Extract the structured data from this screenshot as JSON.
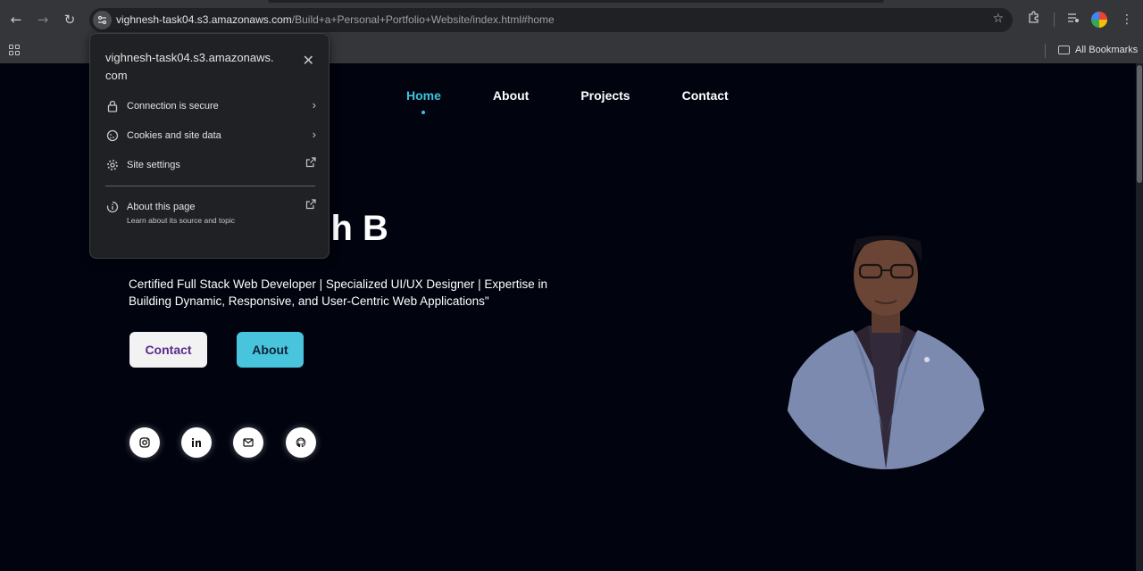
{
  "browser": {
    "url_host": "vighnesh-task04.s3.amazonaws.com",
    "url_path": "/Build+a+Personal+Portfolio+Website/index.html#home",
    "all_bookmarks_label": "All Bookmarks"
  },
  "site_info_popup": {
    "host": "vighnesh-task04.s3.amazonaws.com",
    "items": [
      {
        "label": "Connection is secure"
      },
      {
        "label": "Cookies and site data"
      },
      {
        "label": "Site settings"
      }
    ],
    "about": {
      "label": "About this page",
      "sublabel": "Learn about its source and topic"
    }
  },
  "site": {
    "nav": [
      {
        "label": "Home",
        "active": true
      },
      {
        "label": "About",
        "active": false
      },
      {
        "label": "Projects",
        "active": false
      },
      {
        "label": "Contact",
        "active": false
      }
    ],
    "hero_name_visible": "esh B",
    "tagline": "Certified Full Stack Web Developer | Specialized UI/UX Designer | Expertise in Building Dynamic, Responsive, and User-Centric Web Applications\"",
    "buttons": {
      "contact": "Contact",
      "about": "About"
    },
    "socials": [
      "instagram-icon",
      "linkedin-icon",
      "mail-icon",
      "github-icon"
    ]
  },
  "colors": {
    "accent": "#3ec2dc",
    "page_bg": "#01030f",
    "contact_text": "#5a2a90"
  }
}
